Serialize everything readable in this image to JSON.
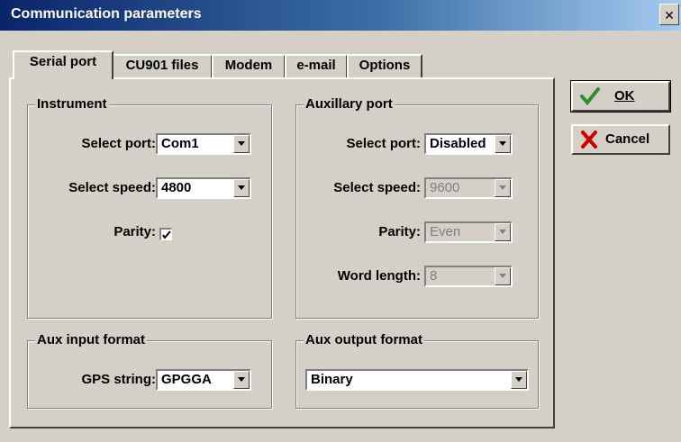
{
  "window": {
    "title": "Communication parameters",
    "close_glyph": "✕"
  },
  "tabs": [
    {
      "label": "Serial port"
    },
    {
      "label": "CU901 files"
    },
    {
      "label": "Modem"
    },
    {
      "label": "e-mail"
    },
    {
      "label": "Options"
    }
  ],
  "buttons": {
    "ok_label": "OK",
    "cancel_label": "Cancel",
    "ok_icon": "checkmark-icon",
    "cancel_icon": "red-x-icon"
  },
  "instrument": {
    "title": "Instrument",
    "port_label": "Select port:",
    "port_value": "Com1",
    "speed_label": "Select speed:",
    "speed_value": "4800",
    "parity_label": "Parity:",
    "parity_checked": true
  },
  "aux_port": {
    "title": "Auxillary port",
    "port_label": "Select port:",
    "port_value": "Disabled",
    "speed_label": "Select speed:",
    "speed_value": "9600",
    "parity_label": "Parity:",
    "parity_value": "Even",
    "wordlen_label": "Word length:",
    "wordlen_value": "8"
  },
  "aux_input": {
    "title": "Aux input format",
    "gps_label": "GPS string:",
    "gps_value": "GPGGA"
  },
  "aux_output": {
    "title": "Aux output format",
    "value": "Binary"
  },
  "colors": {
    "title_start": "#0a246a",
    "title_end": "#a6caf0",
    "face": "#d4d0c8",
    "ok_check": "#2e8b2e",
    "cancel_x": "#cc0000"
  }
}
